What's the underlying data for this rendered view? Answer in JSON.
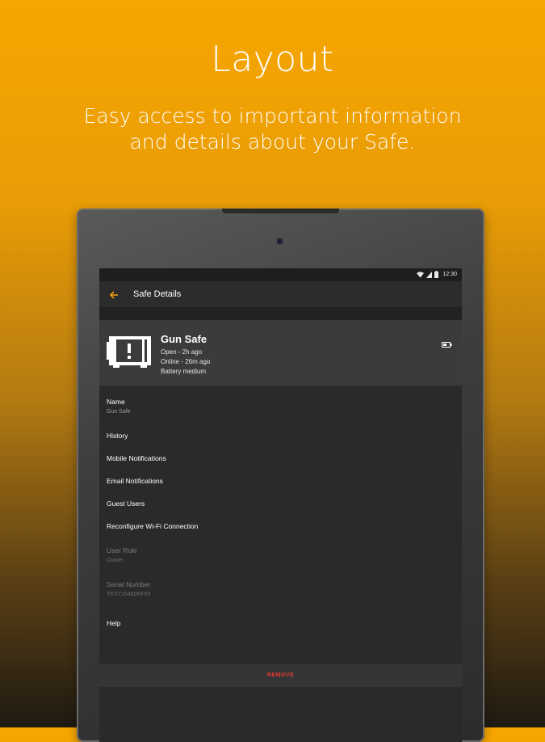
{
  "promo": {
    "headline": "Layout",
    "subline": "Easy access to important information and details about your Safe."
  },
  "statusbar": {
    "time": "12:30",
    "icons": [
      "wifi-icon",
      "cellular-signal-icon",
      "battery-icon"
    ]
  },
  "toolbar": {
    "back_icon": "arrow-left-icon",
    "title": "Safe Details",
    "accent_color": "#f5a00f"
  },
  "device": {
    "name": "Gun Safe",
    "status_open": "Open - 2h ago",
    "status_online": "Online - 26m ago",
    "battery_text": "Battery medium",
    "icon": "safe-alert-icon",
    "battery_icon": "battery-medium-icon"
  },
  "details": {
    "name_label": "Name",
    "name_value": "Gun Safe",
    "history": "History",
    "mobile_notifications": "Mobile Notifications",
    "email_notifications": "Email Notifications",
    "guest_users": "Guest Users",
    "reconfigure_wifi": "Reconfigure Wi-Fi Connection",
    "user_role_label": "User Role",
    "user_role_value": "Owner",
    "serial_label": "Serial Number",
    "serial_value": "TEST16480RF69",
    "help": "Help"
  },
  "actions": {
    "remove": "REMOVE",
    "remove_color": "#e53935"
  }
}
